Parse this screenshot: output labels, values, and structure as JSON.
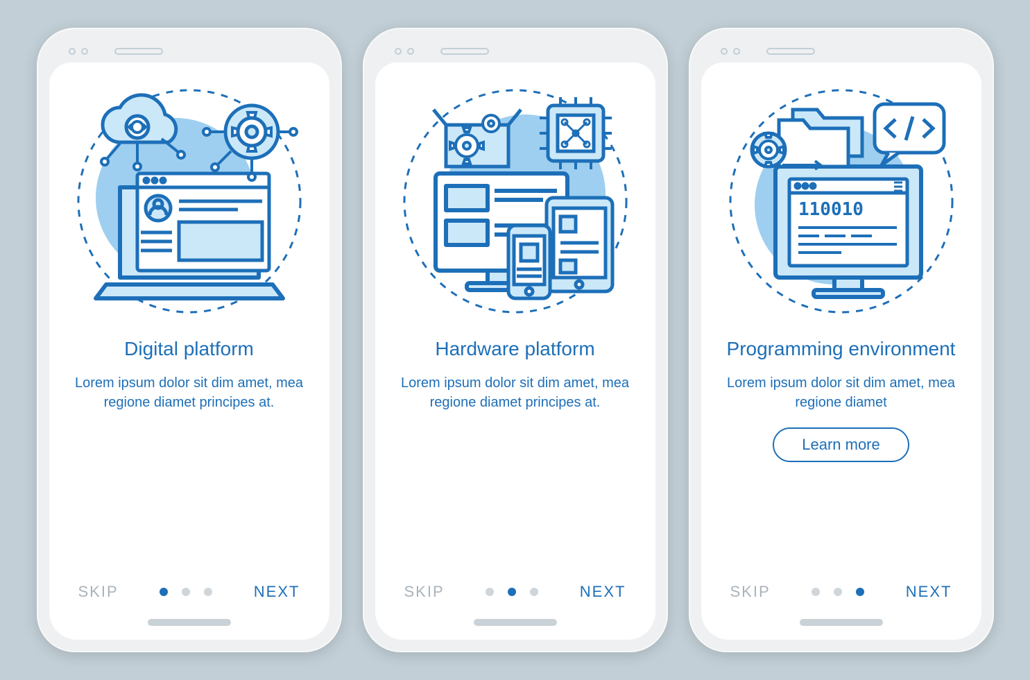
{
  "screens": [
    {
      "title": "Digital platform",
      "desc": "Lorem ipsum dolor sit dim amet, mea regione diamet principes at.",
      "skip": "SKIP",
      "next": "NEXT",
      "active": 0,
      "learn": null
    },
    {
      "title": "Hardware platform",
      "desc": "Lorem ipsum dolor sit dim amet, mea regione diamet principes at.",
      "skip": "SKIP",
      "next": "NEXT",
      "active": 1,
      "learn": null
    },
    {
      "title": "Programming environment",
      "desc": "Lorem ipsum dolor sit dim amet, mea regione diamet",
      "skip": "SKIP",
      "next": "NEXT",
      "active": 2,
      "learn": "Learn more"
    }
  ],
  "binary_code": "110010"
}
